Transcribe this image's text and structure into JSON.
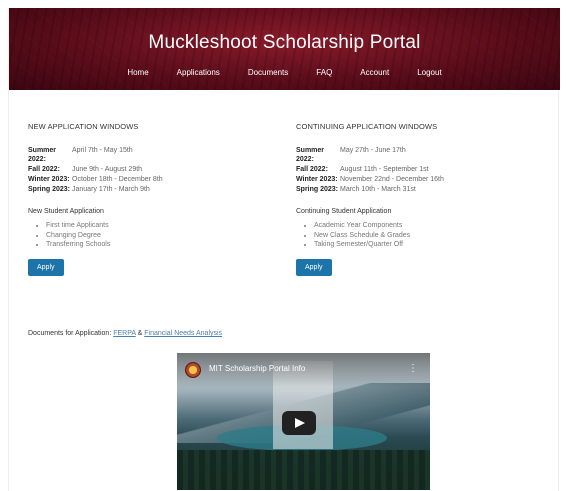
{
  "header": {
    "site_title": "Muckleshoot Scholarship Portal",
    "nav": [
      "Home",
      "Applications",
      "Documents",
      "FAQ",
      "Account",
      "Logout"
    ]
  },
  "new_applications": {
    "heading": "NEW APPLICATION WINDOWS",
    "windows": [
      {
        "term": "Summer 2022:",
        "dates": "April 7th - May 15th"
      },
      {
        "term": "Fall 2022:",
        "dates": "June 9th - August 29th"
      },
      {
        "term": "Winter 2023:",
        "dates": "October 18th - December 8th"
      },
      {
        "term": "Spring 2023:",
        "dates": "January 17th - March 9th"
      }
    ],
    "subheading": "New Student Application",
    "items": [
      "First time Applicants",
      "Changing Degree",
      "Transferring Schools"
    ],
    "apply_label": "Apply"
  },
  "continuing_applications": {
    "heading": "CONTINUING APPLICATION WINDOWS",
    "windows": [
      {
        "term": "Summer 2022:",
        "dates": "May 27th - June 17th"
      },
      {
        "term": "Fall 2022:",
        "dates": "August 11th - September 1st"
      },
      {
        "term": "Winter 2023:",
        "dates": "November 22nd - December 16th"
      },
      {
        "term": "Spring 2023:",
        "dates": "March 10th - March 31st"
      }
    ],
    "subheading": "Continuing Student Application",
    "items": [
      "Academic Year Components",
      "New Class Schedule & Grades",
      "Taking Semester/Quarter Off"
    ],
    "apply_label": "Apply"
  },
  "documents": {
    "label": "Documents for Application:",
    "link1": "FERPA",
    "separator": "&",
    "link2": "Financial Needs Analysis"
  },
  "video": {
    "title": "MIT Scholarship Portal Info",
    "more_icon": "more-vert-icon",
    "play_icon": "play-icon"
  },
  "colors": {
    "banner": "#6b1020",
    "apply_button": "#1c74a8",
    "link": "#4a7fb0"
  }
}
